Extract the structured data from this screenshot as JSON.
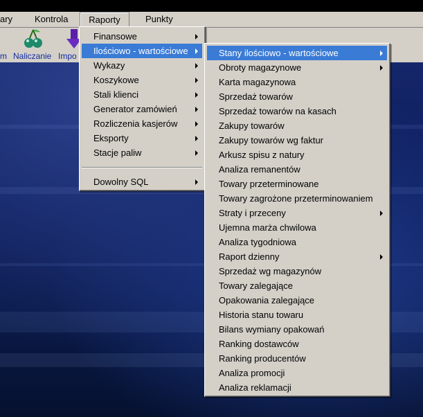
{
  "menubar": {
    "items": [
      {
        "label": "ary"
      },
      {
        "label": "Kontrola"
      },
      {
        "label": "Raporty"
      },
      {
        "label": "Punkty"
      }
    ]
  },
  "toolbar": {
    "buttons": [
      {
        "label": "m",
        "icon": "partial-icon"
      },
      {
        "label": "Naliczanie",
        "icon": "cherries-icon"
      },
      {
        "label": "Impo",
        "icon": "import-arrow-icon"
      }
    ]
  },
  "raporty_menu": {
    "items": [
      {
        "label": "Finansowe",
        "submenu": true
      },
      {
        "label": "Ilościowo - wartościowe",
        "submenu": true
      },
      {
        "label": "Wykazy",
        "submenu": true
      },
      {
        "label": "Koszykowe",
        "submenu": true
      },
      {
        "label": "Stali klienci",
        "submenu": true
      },
      {
        "label": "Generator zamówień",
        "submenu": true
      },
      {
        "label": "Rozliczenia kasjerów",
        "submenu": true
      },
      {
        "label": "Eksporty",
        "submenu": true
      },
      {
        "label": "Stacje paliw",
        "submenu": true
      },
      {
        "label": "Dowolny SQL",
        "submenu": true
      }
    ]
  },
  "ilosciowo_submenu": {
    "items": [
      {
        "label": "Stany ilościowo - wartościowe",
        "submenu": true
      },
      {
        "label": "Obroty magazynowe",
        "submenu": true
      },
      {
        "label": "Karta magazynowa"
      },
      {
        "label": "Sprzedaż towarów"
      },
      {
        "label": "Sprzedaż towarów na kasach"
      },
      {
        "label": "Zakupy towarów"
      },
      {
        "label": "Zakupy towarów wg faktur"
      },
      {
        "label": "Arkusz spisu z natury"
      },
      {
        "label": "Analiza remanentów"
      },
      {
        "label": "Towary przeterminowane"
      },
      {
        "label": "Towary zagrożone przeterminowaniem"
      },
      {
        "label": "Straty i przeceny",
        "submenu": true
      },
      {
        "label": "Ujemna marża chwilowa"
      },
      {
        "label": "Analiza tygodniowa"
      },
      {
        "label": "Raport dzienny",
        "submenu": true
      },
      {
        "label": "Sprzedaż wg magazynów"
      },
      {
        "label": "Towary zalegające"
      },
      {
        "label": "Opakowania zalegające"
      },
      {
        "label": "Historia stanu towaru"
      },
      {
        "label": "Bilans wymiany opakowań"
      },
      {
        "label": "Ranking dostawców"
      },
      {
        "label": "Ranking producentów"
      },
      {
        "label": "Analiza promocji"
      },
      {
        "label": "Analiza reklamacji"
      }
    ]
  },
  "colors": {
    "highlight": "#3a7bd5",
    "menu_bg": "#d4d0c8",
    "desktop": "#0a1a4a",
    "toolbar_text": "#102aa0"
  }
}
